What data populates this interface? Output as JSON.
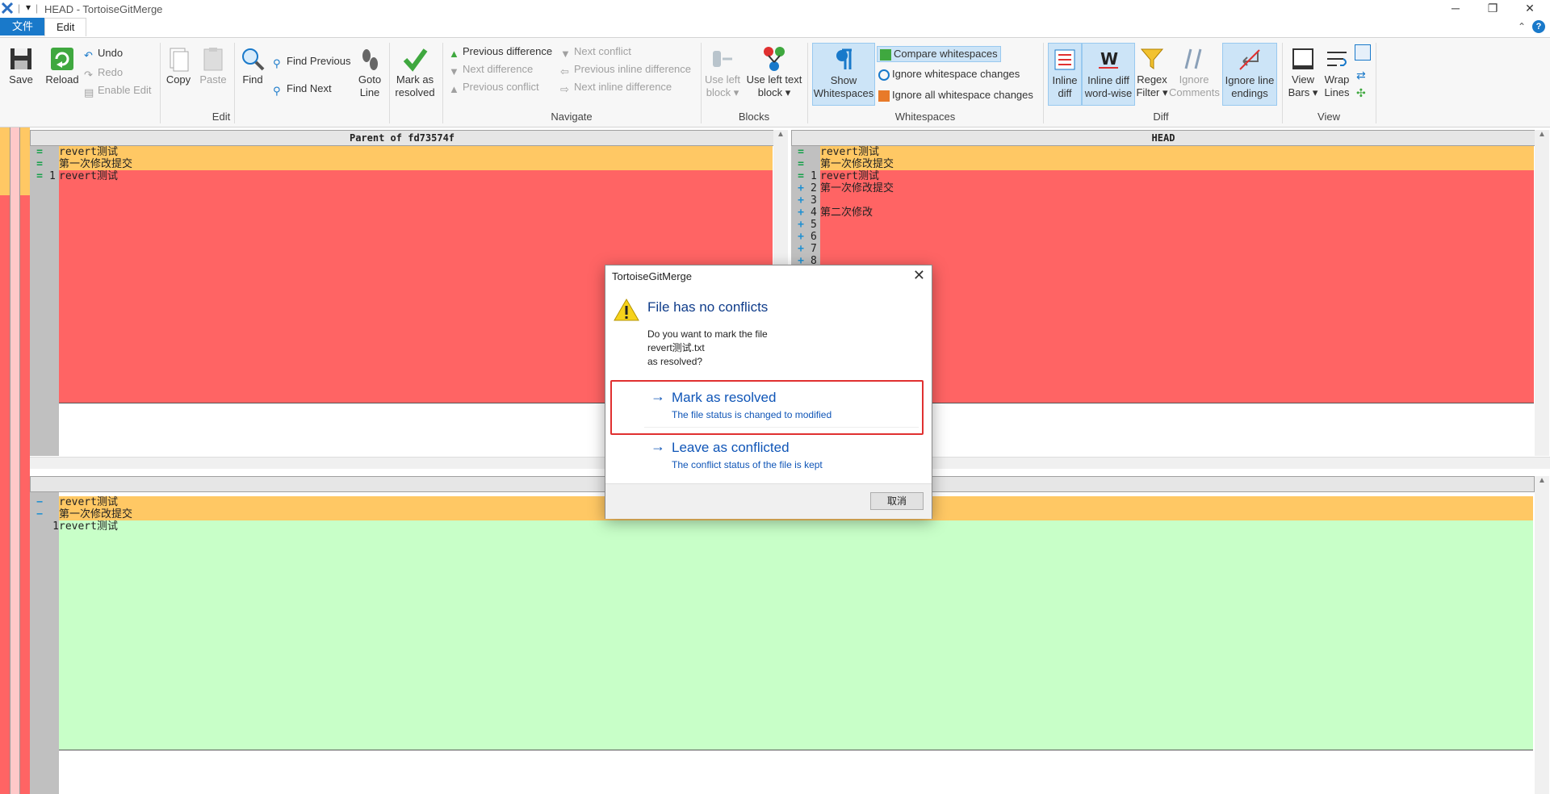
{
  "window": {
    "title": "HEAD - TortoiseGitMerge",
    "help": "?"
  },
  "ribbon_tabs": {
    "file": "文件",
    "edit": "Edit"
  },
  "ribbon": {
    "edit": {
      "save": "Save",
      "reload": "Reload",
      "undo": "Undo",
      "redo": "Redo",
      "enable_edit": "Enable Edit",
      "copy": "Copy",
      "paste": "Paste",
      "find": "Find",
      "find_previous": "Find Previous",
      "find_next": "Find Next",
      "goto_line_1": "Goto",
      "goto_line_2": "Line",
      "mark_resolved_1": "Mark as",
      "mark_resolved_2": "resolved",
      "group": "Edit"
    },
    "navigate": {
      "prev_diff": "Previous difference",
      "next_diff": "Next difference",
      "prev_conflict": "Previous conflict",
      "next_conflict": "Next conflict",
      "prev_inline": "Previous inline difference",
      "next_inline": "Next inline difference",
      "group": "Navigate"
    },
    "blocks": {
      "use_left_block_1": "Use left",
      "use_left_block_2": "block",
      "use_left_text_1": "Use left text",
      "use_left_text_2": "block",
      "group": "Blocks"
    },
    "whitespaces": {
      "show_1": "Show",
      "show_2": "Whitespaces",
      "compare": "Compare whitespaces",
      "ignore_changes": "Ignore whitespace changes",
      "ignore_all": "Ignore all whitespace changes",
      "group": "Whitespaces"
    },
    "diff": {
      "inline_1": "Inline",
      "inline_2": "diff",
      "wordwise_1": "Inline diff",
      "wordwise_2": "word-wise",
      "regex_1": "Regex",
      "regex_2": "Filter",
      "ignore_comments_1": "Ignore",
      "ignore_comments_2": "Comments",
      "ignore_endings_1": "Ignore line",
      "ignore_endings_2": "endings",
      "group": "Diff"
    },
    "view": {
      "view_bars_1": "View",
      "view_bars_2": "Bars",
      "wrap_1": "Wrap",
      "wrap_2": "Lines",
      "group": "View"
    }
  },
  "panes": {
    "left": {
      "header": "Parent of fd73574f",
      "lines": [
        "revert测试",
        "第一次修改提交",
        "revert测试"
      ],
      "marks": [
        "=",
        "=",
        "="
      ],
      "nums": [
        "",
        "",
        "1"
      ]
    },
    "right": {
      "header": "HEAD",
      "lines": [
        "revert测试",
        "第一次修改提交",
        "revert测试",
        "第一次修改提交",
        "",
        "第二次修改",
        "",
        "",
        "",
        ""
      ],
      "marks": [
        "=",
        "=",
        "=",
        "+",
        "+",
        "+",
        "+",
        "+",
        "+",
        "+"
      ],
      "nums": [
        "",
        "",
        "1",
        "2",
        "3",
        "4",
        "5",
        "6",
        "7",
        "8"
      ]
    },
    "bottom": {
      "lines": [
        "revert测试",
        "第一次修改提交",
        "revert测试"
      ],
      "marks": [
        "−",
        "−",
        ""
      ],
      "nums": [
        "",
        "",
        "1"
      ]
    }
  },
  "dialog": {
    "title": "TortoiseGitMerge",
    "heading": "File has no conflicts",
    "body_1": "Do you want to mark the file",
    "body_2": "revert测试.txt",
    "body_3": "as resolved?",
    "opt1_title": "Mark as resolved",
    "opt1_sub": "The file status is changed to modified",
    "opt2_title": "Leave as conflicted",
    "opt2_sub": "The conflict status of the file is kept",
    "cancel": "取消"
  },
  "colors": {
    "conflict_red": "#ff6464",
    "equal_orange": "#ffc864",
    "added_green": "#c8ffc8",
    "accent_blue": "#0f55b7",
    "highlight_box": "#e03030"
  }
}
